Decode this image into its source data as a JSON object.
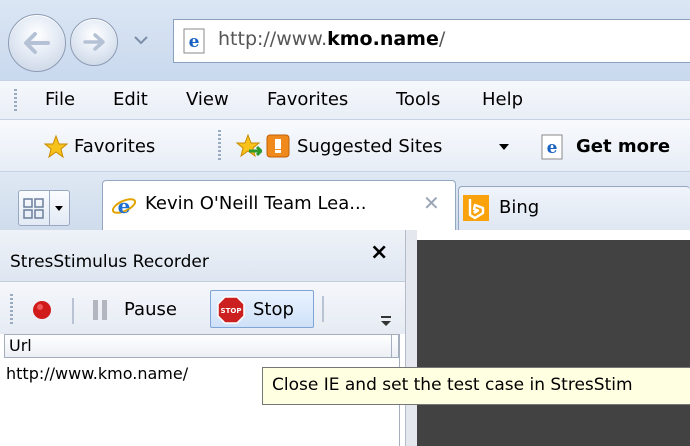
{
  "address_bar": {
    "url_prefix": "http://www.",
    "url_domain": "kmo.name",
    "url_suffix": "/"
  },
  "menu": {
    "items": [
      "File",
      "Edit",
      "View",
      "Favorites",
      "Tools",
      "Help"
    ]
  },
  "favorites_bar": {
    "favorites_label": "Favorites",
    "suggested_sites_label": "Suggested Sites",
    "get_more_label": "Get more"
  },
  "tabs": {
    "active_title": "Kevin O'Neill Team Lea...",
    "second_title": "Bing"
  },
  "recorder": {
    "title": "StresStimulus Recorder",
    "pause_label": "Pause",
    "stop_label": "Stop",
    "stop_icon_text": "STOP",
    "column_url": "Url",
    "rows": [
      "http://www.kmo.name/"
    ],
    "close_glyph": "×"
  },
  "tooltip": {
    "text": "Close IE and set the test case in StresStim"
  },
  "colors": {
    "chrome_blue": "#dbe6f4",
    "right_pane": "#424242",
    "tooltip_bg": "#ffffe1",
    "record_red": "#d11a1a",
    "stop_red": "#cc1f1f"
  }
}
